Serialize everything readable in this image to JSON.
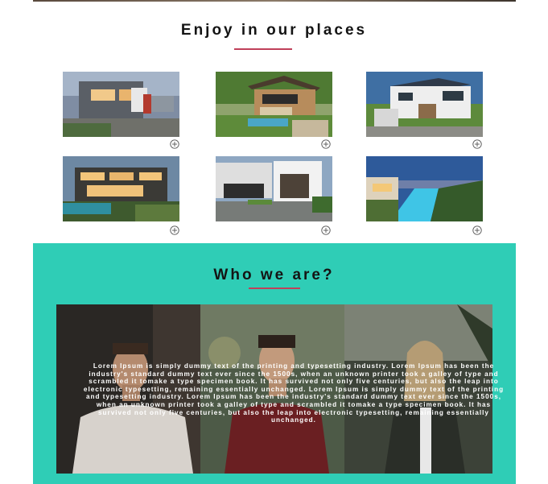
{
  "places": {
    "title": "Enjoy in our places",
    "gallery": [
      {
        "alt": "Modern two-storey house at dusk",
        "icon": "zoom-plus-icon"
      },
      {
        "alt": "Wooden modern house with pool",
        "icon": "zoom-plus-icon"
      },
      {
        "alt": "White villa with garden",
        "icon": "zoom-plus-icon"
      },
      {
        "alt": "Large modern house with pool at dusk",
        "icon": "zoom-plus-icon"
      },
      {
        "alt": "White cubic house with garage",
        "icon": "zoom-plus-icon"
      },
      {
        "alt": "House with pool overlooking city at dusk",
        "icon": "zoom-plus-icon"
      }
    ]
  },
  "about": {
    "title": "Who we are?",
    "background_color": "#2fcdb6",
    "accent_color": "#c0405a",
    "description": "Lorem Ipsum is simply dummy text of the printing and typesetting industry. Lorem Ipsum has been the industry's standard dummy text ever since the 1500s, when an unknown printer took a galley of type and scrambled it tomake a type specimen book. It has survived not only five centuries, but also the leap into electronic typesetting, remaining essentially unchanged. Lorem Ipsum is simply dummy text of the printing and typesetting industry. Lorem Ipsum has been the industry's standard dummy text ever since the 1500s, when an unknown printer took a galley of type and scrambled it tomake a type specimen book. It has survived not only five centuries, but also the leap into electronic typesetting, remaining essentially unchanged."
  }
}
